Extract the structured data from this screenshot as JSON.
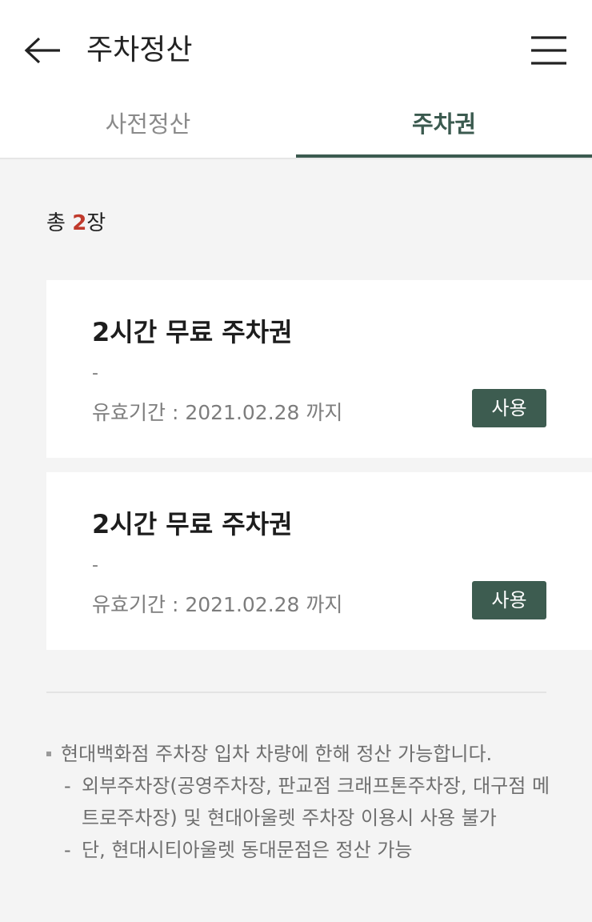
{
  "header": {
    "title": "주차정산"
  },
  "tabs": [
    {
      "label": "사전정산",
      "active": false
    },
    {
      "label": "주차권",
      "active": true
    }
  ],
  "summary": {
    "prefix": "총 ",
    "count": "2",
    "suffix": "장"
  },
  "tickets": [
    {
      "title": "2시간 무료 주차권",
      "subtitle": "-",
      "valid_label": "유효기간 : 2021.02.28 까지",
      "button_label": "사용"
    },
    {
      "title": "2시간 무료 주차권",
      "subtitle": "-",
      "valid_label": "유효기간 : 2021.02.28 까지",
      "button_label": "사용"
    }
  ],
  "notes": {
    "main": "현대백화점 주차장 입차 차량에 한해 정산 가능합니다.",
    "sub_items": [
      "외부주차장(공영주차장, 판교점 크래프톤주차장, 대구점 메트로주차장) 및 현대아울렛 주차장 이용시 사용 불가",
      "단, 현대시티아울렛 동대문점은 정산 가능"
    ]
  },
  "colors": {
    "accent": "#3b5a4f",
    "count_highlight": "#c0392b",
    "background": "#f4f4f4"
  }
}
